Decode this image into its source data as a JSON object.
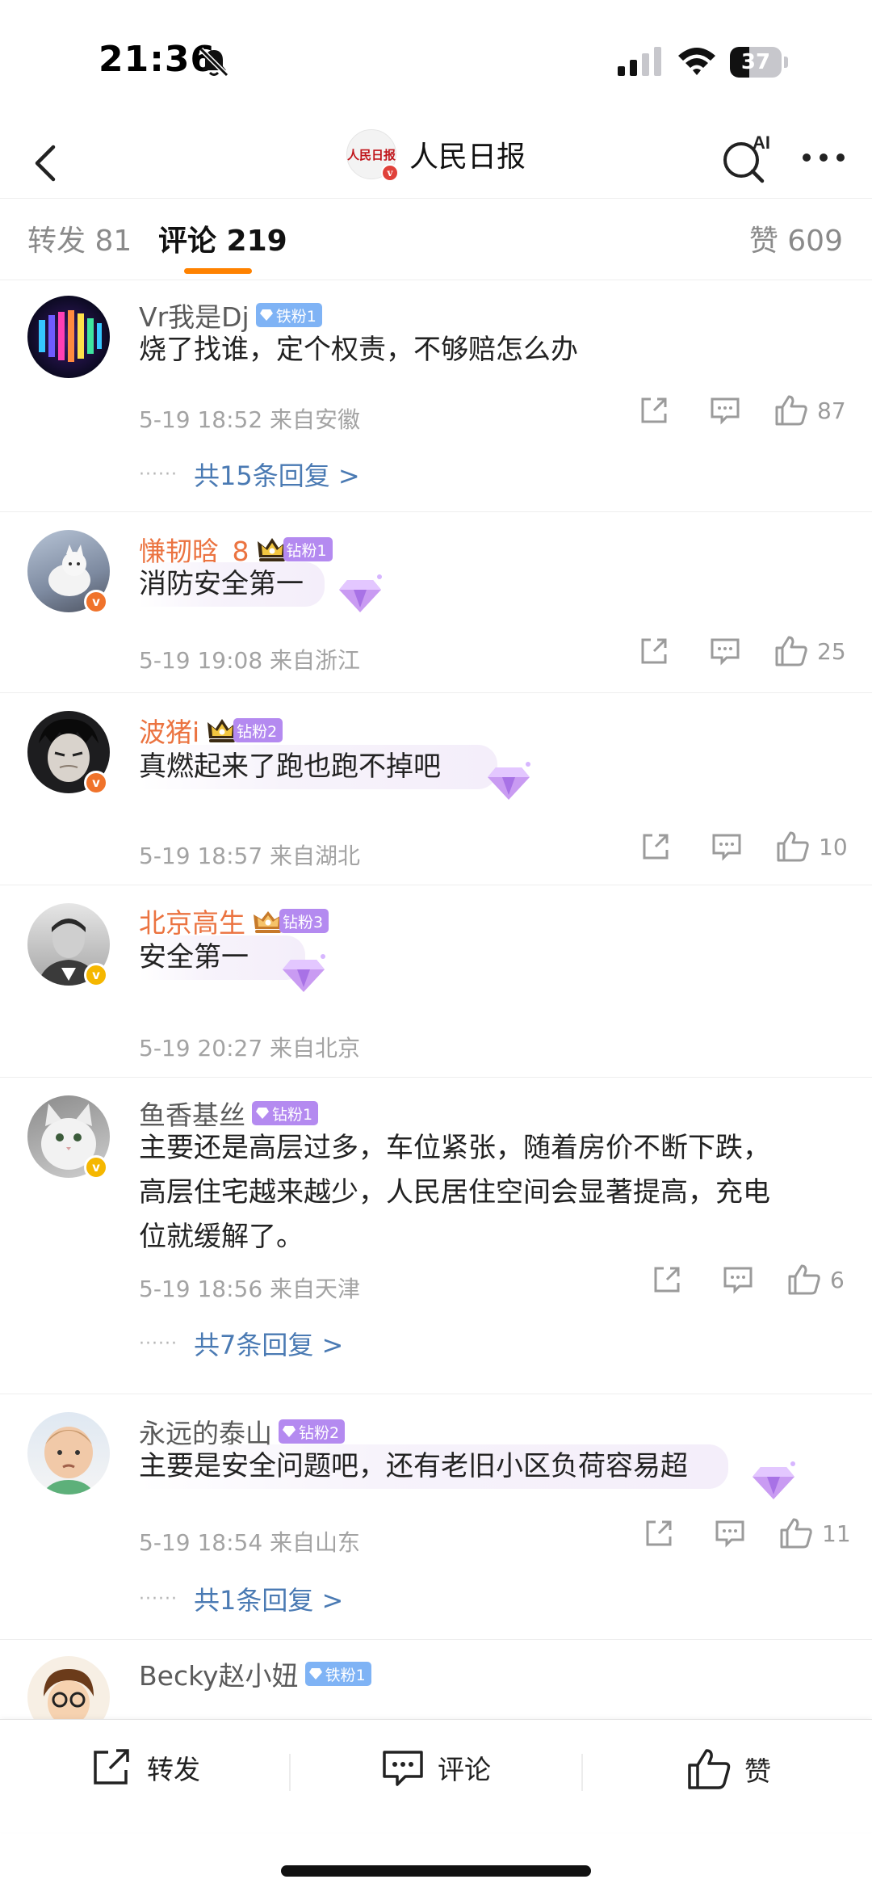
{
  "status_bar": {
    "time": "21:36",
    "battery": "37",
    "battery_fraction": 0.37
  },
  "header": {
    "title": "人民日报",
    "ai_label": "AI",
    "logo_text": "人民日报"
  },
  "tabs": {
    "repost": "转发 81",
    "comment": "评论 219",
    "like": "赞 609"
  },
  "comments": [
    {
      "username": "Vr我是Dj",
      "badge": "铁粉1",
      "content": "烧了找谁，定个权责，不够赔怎么办",
      "time_location": "5-19 18:52  来自安徽",
      "likes": "87",
      "replies": "共15条回复 >"
    },
    {
      "username": "慊韧晗_8",
      "badge": "钻粉1",
      "content": "消防安全第一",
      "time_location": "5-19 19:08  来自浙江",
      "likes": "25"
    },
    {
      "username": "波猪i",
      "badge": "钻粉2",
      "content": "真燃起来了跑也跑不掉吧",
      "time_location": "5-19 18:57  来自湖北",
      "likes": "10"
    },
    {
      "username": "北京高生",
      "badge": "钻粉3",
      "content": "安全第一",
      "time_location": "5-19 20:27  来自北京"
    },
    {
      "username": "鱼香基丝",
      "badge": "钻粉1",
      "content_lines": [
        "主要还是高层过多，车位紧张，随着房价不断下跌，",
        "高层住宅越来越少，人民居住空间会显著提高，充电",
        "位就缓解了。"
      ],
      "time_location": "5-19 18:56  来自天津",
      "likes": "6",
      "replies": "共7条回复 >"
    },
    {
      "username": "永远的泰山",
      "badge": "钻粉2",
      "content": "主要是安全问题吧，还有老旧小区负荷容易超",
      "time_location": "5-19 18:54  来自山东",
      "likes": "11",
      "replies": "共1条回复 >"
    },
    {
      "username": "Becky赵小妞",
      "badge": "铁粉1"
    }
  ],
  "bottom_bar": {
    "repost": "转发",
    "comment": "评论",
    "like": "赞"
  },
  "colors": {
    "accent": "#ff8200",
    "vip_name": "#eb7340",
    "reply_link": "#4a7ab3",
    "iron_fan": "#7fb3f5",
    "diamond_fan": "#b48af0"
  }
}
